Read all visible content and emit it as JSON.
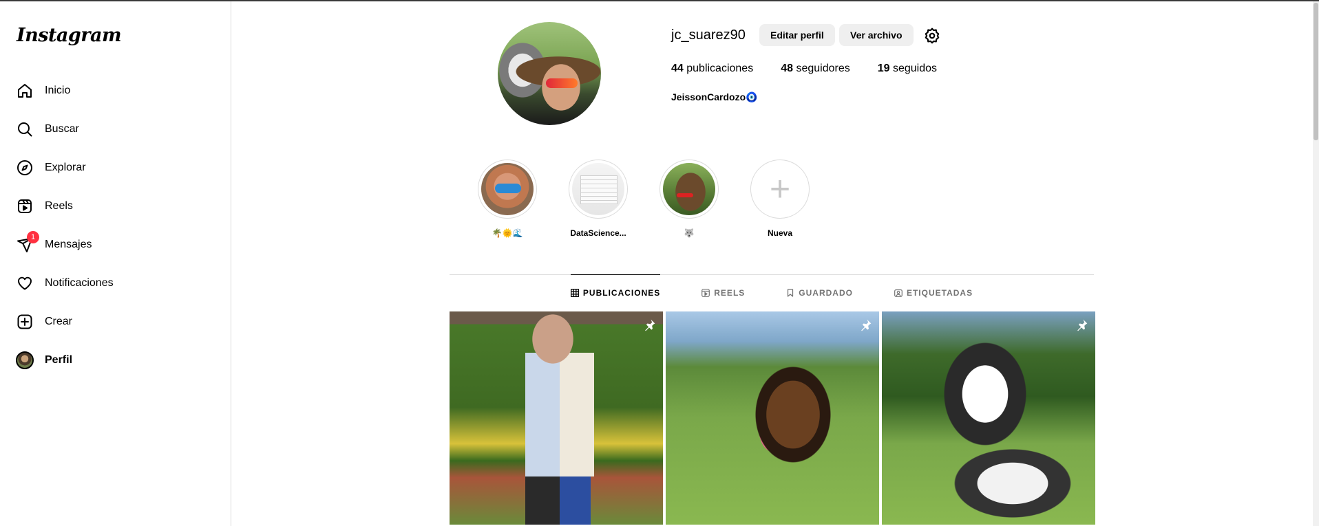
{
  "sidebar": {
    "logo": "Instagram",
    "items": [
      {
        "label": "Inicio",
        "icon": "home-icon"
      },
      {
        "label": "Buscar",
        "icon": "search-icon"
      },
      {
        "label": "Explorar",
        "icon": "compass-icon"
      },
      {
        "label": "Reels",
        "icon": "reels-icon"
      },
      {
        "label": "Mensajes",
        "icon": "messenger-icon",
        "badge": "1"
      },
      {
        "label": "Notificaciones",
        "icon": "heart-icon"
      },
      {
        "label": "Crear",
        "icon": "plus-square-icon"
      },
      {
        "label": "Perfil",
        "icon": "avatar",
        "active": true
      }
    ]
  },
  "profile": {
    "username": "jc_suarez90",
    "edit_label": "Editar perfil",
    "archive_label": "Ver archivo",
    "stats": {
      "posts_count": "44",
      "posts_label": "publicaciones",
      "followers_count": "48",
      "followers_label": "seguidores",
      "following_count": "19",
      "following_label": "seguidos"
    },
    "full_name": "JeissonCardozo🧿"
  },
  "highlights": [
    {
      "label": "🌴🌞🌊"
    },
    {
      "label": "DataScience..."
    },
    {
      "label": "🐺"
    },
    {
      "label": "Nueva"
    }
  ],
  "tabs": [
    {
      "label": "PUBLICACIONES",
      "icon": "grid-icon",
      "active": true
    },
    {
      "label": "REELS",
      "icon": "reels-icon"
    },
    {
      "label": "GUARDADO",
      "icon": "bookmark-icon"
    },
    {
      "label": "ETIQUETADAS",
      "icon": "tagged-icon"
    }
  ],
  "posts": [
    {
      "pinned": true
    },
    {
      "pinned": true
    },
    {
      "pinned": true
    }
  ],
  "colors": {
    "badge": "#ff3040",
    "button_bg": "#efefef",
    "border": "#dbdbdb",
    "muted_text": "#737373"
  }
}
